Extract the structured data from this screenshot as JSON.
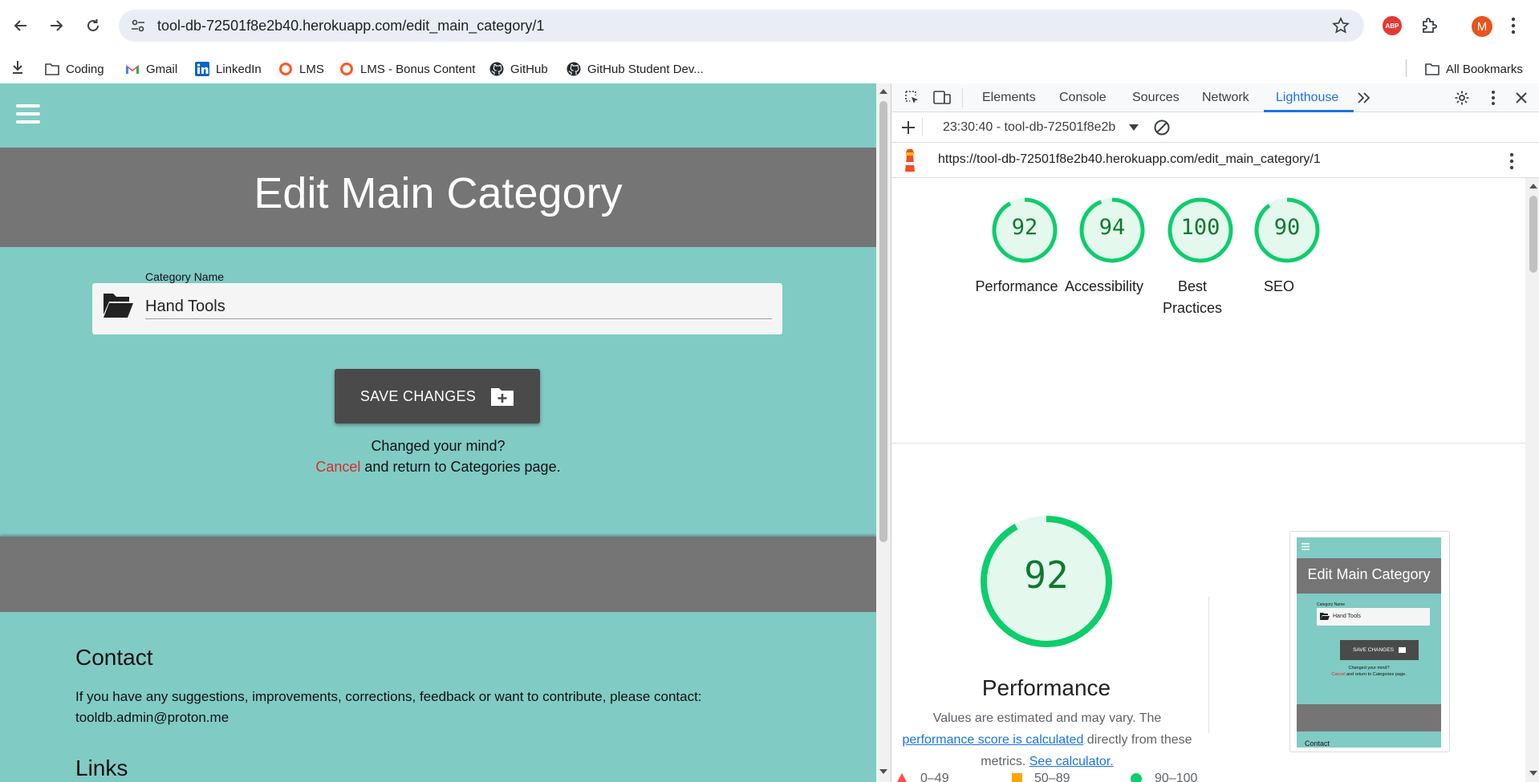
{
  "browser": {
    "url": "tool-db-72501f8e2b40.herokuapp.com/edit_main_category/1",
    "profile_initial": "M",
    "abp_label": "ABP",
    "bookmarks": [
      {
        "label": "Coding",
        "icon": "folder-icon"
      },
      {
        "label": "Gmail",
        "icon": "gmail-icon"
      },
      {
        "label": "LinkedIn",
        "icon": "linkedin-icon"
      },
      {
        "label": "LMS",
        "icon": "lms-icon"
      },
      {
        "label": "LMS - Bonus Content",
        "icon": "lms-icon"
      },
      {
        "label": "GitHub",
        "icon": "github-icon"
      },
      {
        "label": "GitHub Student Dev...",
        "icon": "github-icon"
      }
    ],
    "all_bookmarks": "All Bookmarks"
  },
  "page": {
    "title": "Edit Main Category",
    "field_label": "Category Name",
    "field_value": "Hand Tools",
    "save_label": "SAVE CHANGES",
    "changed_mind": "Changed your mind?",
    "cancel_link": "Cancel",
    "cancel_rest": " and return to Categories page.",
    "contact_title": "Contact",
    "contact_text": "If you have any suggestions, improvements, corrections, feedback or want to contribute, please contact: tooldb.admin@proton.me",
    "links_title": "Links",
    "colors": {
      "teal": "#80cbc4",
      "gray": "#757575",
      "button": "#4a4a4a",
      "cancel": "#d32f2f"
    }
  },
  "devtools": {
    "tabs": [
      "Elements",
      "Console",
      "Sources",
      "Network",
      "Lighthouse"
    ],
    "active_tab": "Lighthouse",
    "report_select": "23:30:40 - tool-db-72501f8e2b",
    "report_url": "https://tool-db-72501f8e2b40.herokuapp.com/edit_main_category/1",
    "scores": [
      {
        "label": "Performance",
        "value": 92
      },
      {
        "label": "Accessibility",
        "value": 94
      },
      {
        "label": "Best Practices",
        "value": 100
      },
      {
        "label": "SEO",
        "value": 90
      }
    ],
    "perf": {
      "value": 92,
      "title": "Performance",
      "desc_1": "Values are estimated and may vary. The",
      "desc_link_1": "performance score is calculated",
      "desc_2": " directly from these metrics. ",
      "desc_link_2": "See calculator.",
      "legend": [
        "0–49",
        "50–89",
        "90–100"
      ]
    },
    "thumbnail": {
      "title": "Edit Main Category",
      "field_label": "Category Name",
      "field_value": "Hand Tools",
      "save_label": "SAVE CHANGES",
      "changed_mind": "Changed your mind?",
      "cancel_link": "Cancel",
      "cancel_rest": " and return to Categories page.",
      "contact": "Contact"
    },
    "colors": {
      "pass": "#0cce6b",
      "pass_text": "#0c7a2e",
      "pass_bg": "#e5f8ee",
      "average": "#ffa400",
      "fail": "#ff4e42",
      "accent": "#1a73e8"
    }
  }
}
